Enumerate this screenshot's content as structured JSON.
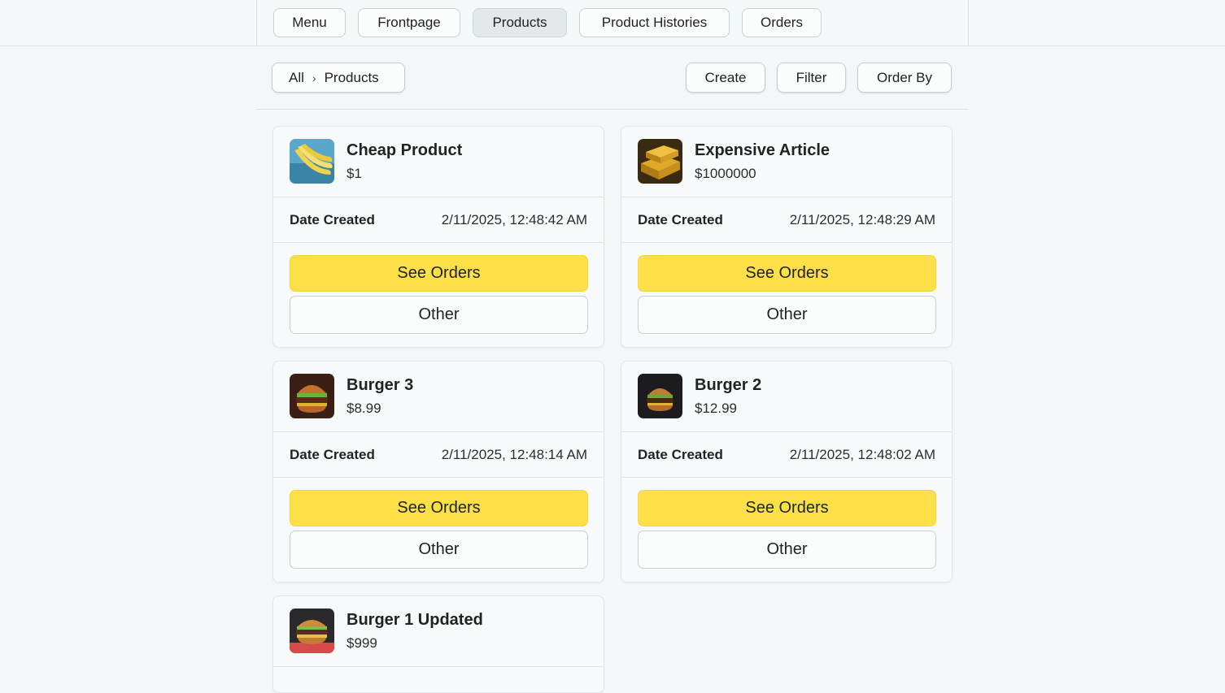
{
  "nav": {
    "items": [
      {
        "label": "Menu",
        "active": false
      },
      {
        "label": "Frontpage",
        "active": false
      },
      {
        "label": "Products",
        "active": true
      },
      {
        "label": "Product Histories",
        "active": false
      },
      {
        "label": "Orders",
        "active": false
      }
    ]
  },
  "breadcrumb": {
    "root": "All",
    "separator": "›",
    "current": "Products"
  },
  "toolbar": {
    "create": "Create",
    "filter": "Filter",
    "order_by": "Order By"
  },
  "colors": {
    "primary_button": "#fde047",
    "background": "#f4f7f8",
    "border": "#c9ced2"
  },
  "products": [
    {
      "title": "Cheap Product",
      "price": "$1",
      "date_label": "Date Created",
      "date": "2/11/2025, 12:48:42 AM",
      "primary": "See Orders",
      "secondary": "Other",
      "thumbnail": "banana-image"
    },
    {
      "title": "Expensive Article",
      "price": "$1000000",
      "date_label": "Date Created",
      "date": "2/11/2025, 12:48:29 AM",
      "primary": "See Orders",
      "secondary": "Other",
      "thumbnail": "gold-bar-image"
    },
    {
      "title": "Burger 3",
      "price": "$8.99",
      "date_label": "Date Created",
      "date": "2/11/2025, 12:48:14 AM",
      "primary": "See Orders",
      "secondary": "Other",
      "thumbnail": "burger-image"
    },
    {
      "title": "Burger 2",
      "price": "$12.99",
      "date_label": "Date Created",
      "date": "2/11/2025, 12:48:02 AM",
      "primary": "See Orders",
      "secondary": "Other",
      "thumbnail": "burger-image"
    },
    {
      "title": "Burger 1 Updated",
      "price": "$999",
      "date_label": "",
      "date": "",
      "primary": "",
      "secondary": "",
      "thumbnail": "burger-image"
    }
  ]
}
